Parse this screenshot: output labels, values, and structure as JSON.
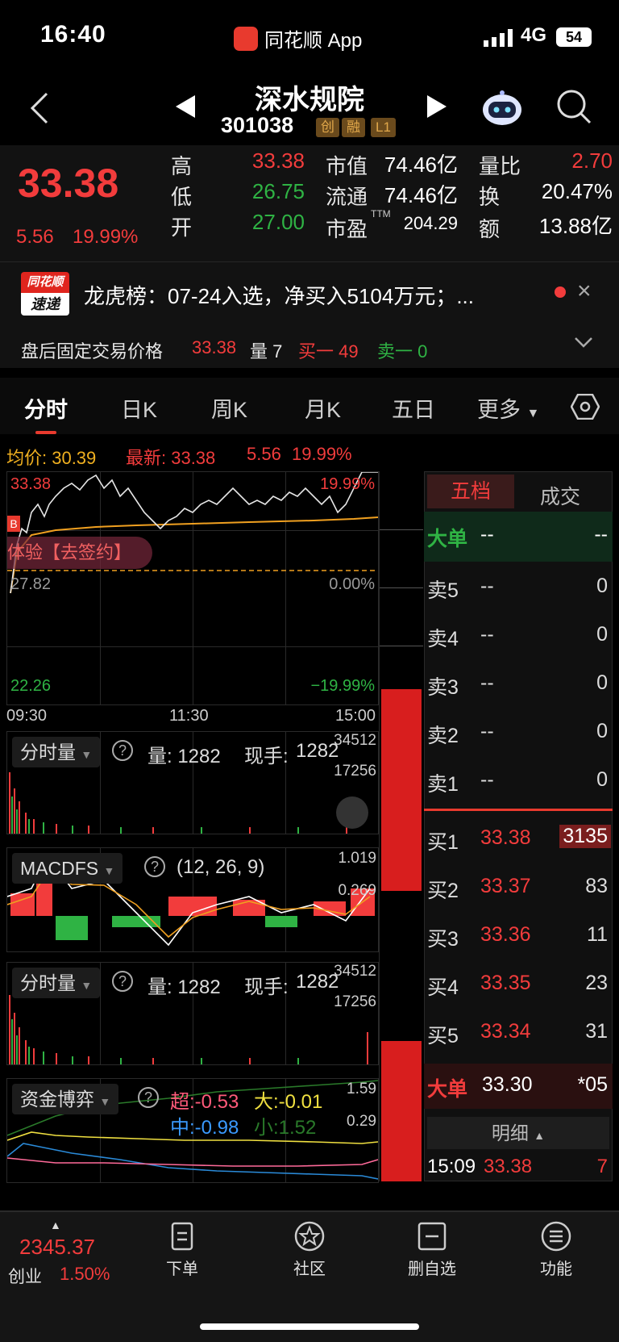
{
  "status": {
    "time": "16:40",
    "app": "同花顺 App",
    "network": "4G",
    "battery": "54"
  },
  "header": {
    "title": "深水规院",
    "code": "301038",
    "tags": [
      "创",
      "融",
      "L1"
    ]
  },
  "quote": {
    "price": "33.38",
    "change": "5.56",
    "change_pct": "19.99%",
    "high_label": "高",
    "high": "33.38",
    "low_label": "低",
    "low": "26.75",
    "open_label": "开",
    "open": "27.00",
    "mktcap_label": "市值",
    "mktcap": "74.46亿",
    "float_label": "流通",
    "float": "74.46亿",
    "pe_label": "市盈",
    "pe_sup": "TTM",
    "pe": "204.29",
    "vr_label": "量比",
    "vr": "2.70",
    "turn_label": "换",
    "turn": "20.47%",
    "amt_label": "额",
    "amt": "13.88亿"
  },
  "news": {
    "badge_top": "同花顺",
    "badge_bottom": "速递",
    "text": "龙虎榜：07-24入选，净买入5104万元；..."
  },
  "afterhours": {
    "label": "盘后固定交易价格",
    "price": "33.38",
    "vol": "量 7",
    "buy": "买一 49",
    "sell": "卖一 0"
  },
  "tabs": [
    "分时",
    "日K",
    "周K",
    "月K",
    "五日",
    "更多"
  ],
  "chart": {
    "avg_label": "均价: 30.39",
    "latest_label": "最新: 33.38",
    "latest_chg": "5.56",
    "latest_pct": "19.99%",
    "top_price": "33.38",
    "top_pct": "19.99%",
    "mid_price": "27.82",
    "mid_pct": "0.00%",
    "bot_price": "22.26",
    "bot_pct": "−19.99%",
    "overlay": "体验【去签约】",
    "time_start": "09:30",
    "time_mid": "11:30",
    "time_end": "15:00",
    "buy_marker": "B"
  },
  "vol1": {
    "label": "分时量",
    "qty_label": "量: 1282",
    "hand_label": "现手:",
    "hand": "1282",
    "max": "34512",
    "half": "17256"
  },
  "macd": {
    "label": "MACDFS",
    "params": "(12, 26, 9)",
    "max": "1.019",
    "mid": "0.269"
  },
  "vol2": {
    "label": "分时量",
    "qty_label": "量: 1282",
    "hand_label": "现手:",
    "hand": "1282",
    "max": "34512",
    "half": "17256"
  },
  "fund": {
    "label": "资金博弈",
    "super": "超:-0.53",
    "big": "大:-0.01",
    "mid": "中:-0.98",
    "small": "小:1.52",
    "max": "1.59",
    "mid_val": "0.29"
  },
  "book": {
    "tab_five": "五档",
    "tab_deal": "成交",
    "big_label": "大单",
    "big_price": "--",
    "big_vol": "--",
    "sells": [
      {
        "label": "卖5",
        "price": "--",
        "vol": "0"
      },
      {
        "label": "卖4",
        "price": "--",
        "vol": "0"
      },
      {
        "label": "卖3",
        "price": "--",
        "vol": "0"
      },
      {
        "label": "卖2",
        "price": "--",
        "vol": "0"
      },
      {
        "label": "卖1",
        "price": "--",
        "vol": "0"
      }
    ],
    "buys": [
      {
        "label": "买1",
        "price": "33.38",
        "vol": "3135"
      },
      {
        "label": "买2",
        "price": "33.37",
        "vol": "83"
      },
      {
        "label": "买3",
        "price": "33.36",
        "vol": "11"
      },
      {
        "label": "买4",
        "price": "33.35",
        "vol": "23"
      },
      {
        "label": "买5",
        "price": "33.34",
        "vol": "31"
      }
    ],
    "big2_label": "大单",
    "big2_price": "33.30",
    "big2_vol": "*05",
    "detail_label": "明细",
    "last_time": "15:09",
    "last_price": "33.38",
    "last_vol": "7"
  },
  "bottom": {
    "index_value": "2345.37",
    "index_name": "创业",
    "index_pct": "1.50%",
    "nav": [
      "下单",
      "社区",
      "删自选",
      "功能"
    ]
  },
  "colors": {
    "up": "#f23c3c",
    "down": "#2fb344",
    "avg": "#f0a020",
    "bg": "#000000"
  }
}
